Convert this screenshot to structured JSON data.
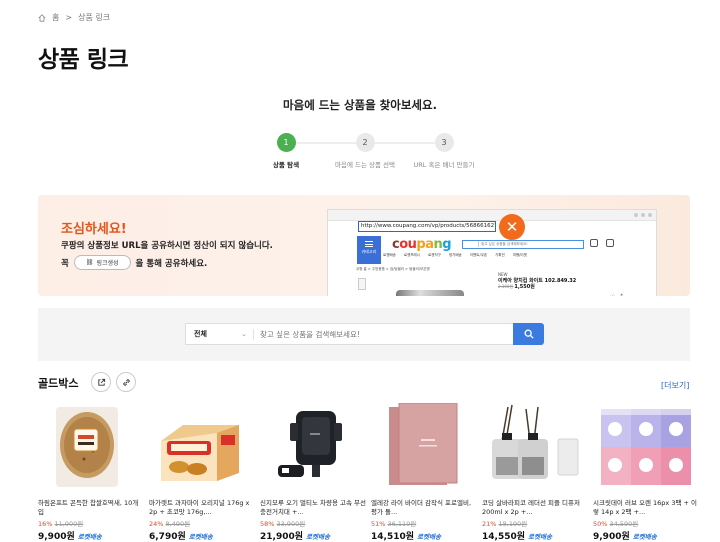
{
  "breadcrumb": {
    "home": "홈",
    "separator": ">",
    "current": "상품 링크"
  },
  "page_title": "상품 링크",
  "steps": {
    "heading": "마음에 드는 상품을 찾아보세요.",
    "items": [
      {
        "number": "1",
        "label": "상품 탐색"
      },
      {
        "number": "2",
        "label": "마음에 드는 상품 선택"
      },
      {
        "number": "3",
        "label": "URL 혹은 배너 만들기"
      }
    ]
  },
  "notice": {
    "title": "조심하세요!",
    "text": "쿠팡의 상품정보 URL을 공유하시면 정산이 되지 않습니다.",
    "prefix": "꼭",
    "pill_label": "링크생성",
    "suffix": "을 통해 공유하세요.",
    "browser": {
      "url": "http://www.coupang.com/vp/products/568661627itemid",
      "close": "✕",
      "menu_label": "카테고리",
      "logo": [
        "c",
        "ou",
        "pa",
        "n",
        "g"
      ],
      "search_placeholder": "찾고 싶은 상품을 검색해보세요!",
      "subnav": [
        "로켓배송",
        "로켓프레시",
        "로켓직구",
        "정기배송",
        "이벤트/쿠폰",
        "기획전",
        "여행/티켓"
      ],
      "crumb": "쿠팡 홈 > 주방용품 > 컵/텀블러 > 텀블러/보온병",
      "product_brand": "NEW",
      "product_name": "이케아 양치컵 화이트 102.849.32",
      "product_price": "1,550원",
      "product_old": "2,100원",
      "icons": "♡ ⤴"
    }
  },
  "search": {
    "select": "전체",
    "placeholder": "찾고 싶은 상품을 검색해보세요!"
  },
  "goldbox": {
    "title": "골드박스",
    "more": "[더보기]",
    "products": [
      {
        "name": "하림온프트 꼰득한 찹쌀호떡새, 10개입",
        "pct": "16%",
        "orig": "11,900원",
        "price": "9,900원",
        "rocket": "로켓배송"
      },
      {
        "name": "마가렛트 과자마이 오리지널 176g x 2p + 초코맛 176g,...",
        "pct": "24%",
        "orig": "8,490원",
        "price": "6,790원",
        "rocket": "로켓배송"
      },
      {
        "name": "신지모루 오기 멀티노 차량용 고속 무선충전거치대 +...",
        "pct": "58%",
        "orig": "33,900원",
        "price": "21,900원",
        "rocket": "로켓배송"
      },
      {
        "name": "엘레강 라이 바이더 감작식 포로엘비, 평가 돌...",
        "pct": "51%",
        "orig": "36,110원",
        "price": "14,510원",
        "rocket": "로켓배송"
      },
      {
        "name": "코딩 살바라피코 레더선 피플 디퓨저 200ml x 2p +...",
        "pct": "21%",
        "orig": "18,190원",
        "price": "14,550원",
        "rocket": "로켓배송"
      },
      {
        "name": "시크릿데이 러브 오렌 16px 3팩 + 이렇 14p x 2팩 +...",
        "pct": "50%",
        "orig": "34,590원",
        "price": "9,900원",
        "rocket": "로켓배송"
      }
    ]
  }
}
